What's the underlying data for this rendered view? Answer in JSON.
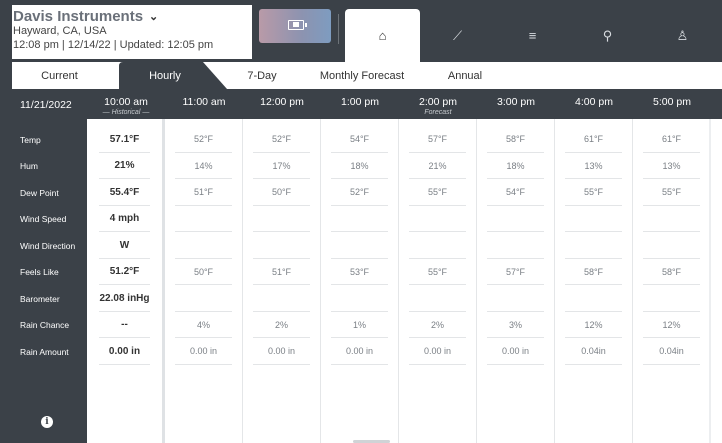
{
  "station": {
    "name": "Davis Instruments",
    "location": "Hayward, CA, USA",
    "time_line": "12:08 pm | 12/14/22 | Updated: 12:05 pm"
  },
  "nav": {
    "tabs": [
      {
        "icon": "home-icon",
        "glyph": "⌂"
      },
      {
        "icon": "chart-icon",
        "glyph": "⟋"
      },
      {
        "icon": "list-icon",
        "glyph": "≡"
      },
      {
        "icon": "location-pin-icon",
        "glyph": "⚲"
      },
      {
        "icon": "user-icon",
        "glyph": "♙"
      }
    ]
  },
  "subtabs": [
    "Current",
    "Hourly",
    "7-Day",
    "Monthly Forecast",
    "Annual"
  ],
  "date": "11/21/2022",
  "columns": [
    {
      "time": "10:00 am",
      "sub": "Historical"
    },
    {
      "time": "11:00 am",
      "sub": ""
    },
    {
      "time": "12:00 pm",
      "sub": ""
    },
    {
      "time": "1:00 pm",
      "sub": ""
    },
    {
      "time": "2:00 pm",
      "sub": "Forecast"
    },
    {
      "time": "3:00 pm",
      "sub": ""
    },
    {
      "time": "4:00 pm",
      "sub": ""
    },
    {
      "time": "5:00 pm",
      "sub": ""
    }
  ],
  "row_labels": [
    "Temp",
    "Hum",
    "Dew Point",
    "Wind Speed",
    "Wind Direction",
    "Feels Like",
    "Barometer",
    "Rain Chance",
    "Rain Amount"
  ],
  "rows": [
    [
      "57.1°F",
      "52°F",
      "52°F",
      "54°F",
      "57°F",
      "58°F",
      "61°F",
      "61°F"
    ],
    [
      "21%",
      "14%",
      "17%",
      "18%",
      "21%",
      "18%",
      "13%",
      "13%"
    ],
    [
      "55.4°F",
      "51°F",
      "50°F",
      "52°F",
      "55°F",
      "54°F",
      "55°F",
      "55°F"
    ],
    [
      "4 mph",
      "",
      "",
      "",
      "",
      "",
      "",
      ""
    ],
    [
      "W",
      "",
      "",
      "",
      "",
      "",
      "",
      ""
    ],
    [
      "51.2°F",
      "50°F",
      "51°F",
      "53°F",
      "55°F",
      "57°F",
      "58°F",
      "58°F"
    ],
    [
      "22.08 inHg",
      "",
      "",
      "",
      "",
      "",
      "",
      ""
    ],
    [
      "--",
      "4%",
      "2%",
      "1%",
      "2%",
      "3%",
      "12%",
      "12%"
    ],
    [
      "0.00 in",
      "0.00 in",
      "0.00 in",
      "0.00 in",
      "0.00 in",
      "0.00 in",
      "0.04in",
      "0.04in"
    ]
  ],
  "colors": {
    "dark": "#3b4148",
    "accent_gradient_start": "#b99aa8",
    "accent_gradient_end": "#7e9cc0"
  }
}
